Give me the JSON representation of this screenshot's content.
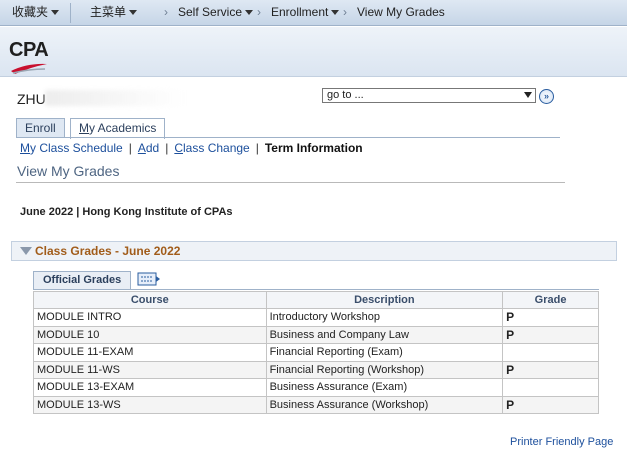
{
  "nav": {
    "favorites": "收藏夹",
    "main_menu": "主菜单",
    "self_service": "Self Service",
    "enrollment": "Enrollment",
    "current": "View My Grades",
    "chevron": "›"
  },
  "brand": {
    "logo_text": "CPA"
  },
  "student": {
    "name": "ZHU"
  },
  "goto": {
    "value": "go to ..."
  },
  "tabs": [
    {
      "label": "Enroll"
    },
    {
      "label": "My Academics"
    }
  ],
  "sublinks": {
    "schedule": "My Class Schedule",
    "add": "Add",
    "change": "Class Change",
    "term_info": "Term Information",
    "separator": "|"
  },
  "page": {
    "title": "View My Grades",
    "term": "June 2022 | Hong Kong Institute of CPAs"
  },
  "section": {
    "title": "Class Grades - June 2022"
  },
  "grid": {
    "tab_label": "Official Grades",
    "columns": [
      "Course",
      "Description",
      "Grade"
    ],
    "rows": [
      {
        "course": "MODULE INTRO",
        "description": "Introductory Workshop",
        "grade": "P"
      },
      {
        "course": "MODULE 10",
        "description": "Business and Company Law",
        "grade": "P"
      },
      {
        "course": "MODULE 11-EXAM",
        "description": "Financial Reporting (Exam)",
        "grade": ""
      },
      {
        "course": "MODULE 11-WS",
        "description": "Financial Reporting (Workshop)",
        "grade": "P"
      },
      {
        "course": "MODULE 13-EXAM",
        "description": "Business Assurance (Exam)",
        "grade": ""
      },
      {
        "course": "MODULE 13-WS",
        "description": "Business Assurance (Workshop)",
        "grade": "P"
      }
    ]
  },
  "footer": {
    "printer_link": "Printer Friendly Page"
  },
  "colors": {
    "link": "#1c4f9c",
    "section_title": "#a15c1a",
    "page_title": "#4e6582",
    "logo_red": "#c8102e"
  }
}
